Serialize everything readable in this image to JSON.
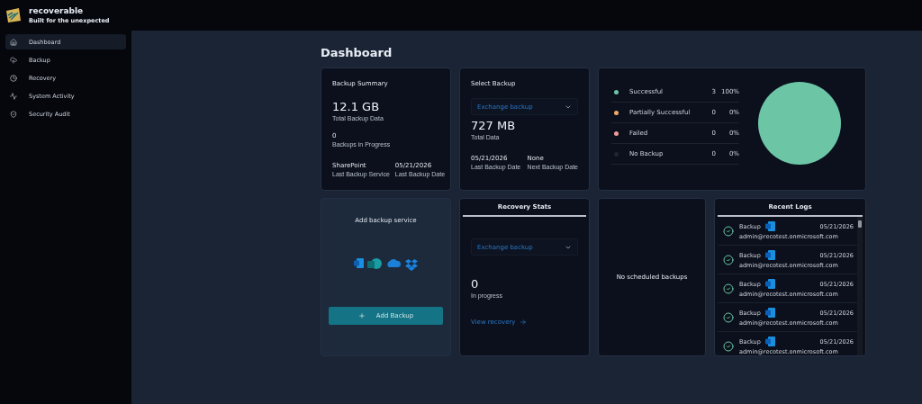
{
  "brand": {
    "name": "recoverable",
    "tagline": "Built for the unexpected"
  },
  "sidebar": {
    "items": [
      {
        "label": "Dashboard",
        "selected": true
      },
      {
        "label": "Backup",
        "selected": false
      },
      {
        "label": "Recovery",
        "selected": false
      },
      {
        "label": "System Activity",
        "selected": false
      },
      {
        "label": "Security Audit",
        "selected": false
      }
    ]
  },
  "page_title": "Dashboard",
  "backup_summary": {
    "title": "Backup Summary",
    "total": "12.1 GB",
    "total_label": "Total Backup Data",
    "in_progress": "0",
    "in_progress_label": "Backups in Progress",
    "service": "SharePoint",
    "service_label": "Last Backup Service",
    "date": "05/21/2026",
    "date_label": "Last Backup Date"
  },
  "select_backup": {
    "title": "Select Backup",
    "dropdown": "Exchange backup",
    "total": "727 MB",
    "total_label": "Total Data",
    "last_date": "05/21/2026",
    "last_date_label": "Last Backup Date",
    "next_date": "None",
    "next_date_label": "Next Backup Date"
  },
  "status": {
    "legend": [
      {
        "count": "3",
        "percent": "100%",
        "color": "#6cc6a6"
      },
      {
        "count": "0",
        "percent": "0%",
        "color": "#f0a86a"
      },
      {
        "count": "0",
        "percent": "0%",
        "color": "#f09a9a"
      },
      {
        "count": "0",
        "percent": "0%",
        "color": "#1e2632"
      }
    ],
    "chart_data": {
      "type": "pie",
      "categories": [
        "Successful",
        "Partially Successful",
        "Failed",
        "No Backup"
      ],
      "values": [
        100,
        0,
        0,
        0
      ]
    }
  },
  "add_service": {
    "title": "Add backup service",
    "button": "Add Backup"
  },
  "recovery_stats": {
    "title": "Recovery Stats",
    "dropdown": "Exchange backup",
    "count": "0",
    "count_label": "In progress",
    "link": "View recovery"
  },
  "schedule": {
    "message": "No scheduled backups"
  },
  "recent_logs": {
    "title": "Recent Logs",
    "items": [
      {
        "type": "Backup",
        "date": "05/21/2026",
        "account": "admin@recotest.onmicrosoft.com"
      },
      {
        "type": "Backup",
        "date": "05/21/2026",
        "account": "admin@recotest.onmicrosoft.com"
      },
      {
        "type": "Backup",
        "date": "05/21/2026",
        "account": "admin@recotest.onmicrosoft.com"
      },
      {
        "type": "Backup",
        "date": "05/21/2026",
        "account": "admin@recotest.onmicrosoft.com"
      },
      {
        "type": "Backup",
        "date": "05/21/2026",
        "account": "admin@recotest.onmicrosoft.com"
      }
    ]
  }
}
